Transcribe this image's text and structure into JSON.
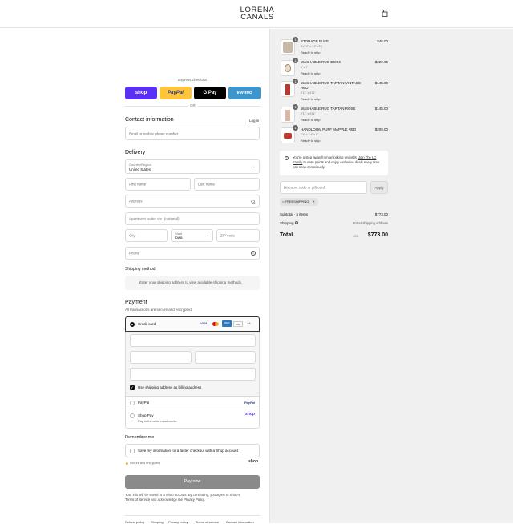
{
  "header": {
    "logo_line1": "LORENA",
    "logo_line2": "CANALS"
  },
  "express": {
    "label": "Express checkout",
    "or": "OR",
    "buttons": [
      {
        "label": "shop"
      },
      {
        "label": "PayPal"
      },
      {
        "label": "G Pay"
      },
      {
        "label": "venmo"
      }
    ],
    "colors": {
      "shop": "#5a31f4",
      "paypal": "#ffc439",
      "gpay": "#000000",
      "venmo": "#3d95ce"
    }
  },
  "contact": {
    "title": "Contact information",
    "login": "Log in",
    "email_placeholder": "Email or mobile phone number"
  },
  "delivery": {
    "title": "Delivery",
    "country_label": "Country/Region",
    "country_value": "United States",
    "first_name": "First name",
    "last_name": "Last name",
    "address": "Address",
    "apartment": "Apartment, suite, etc. (optional)",
    "city": "City",
    "state_label": "State",
    "state_value": "Iowa",
    "zip": "ZIP code",
    "phone": "Phone"
  },
  "shipping_method": {
    "title": "Shipping method",
    "note": "Enter your shipping address to view available shipping methods."
  },
  "payment": {
    "title": "Payment",
    "subtitle": "All transactions are secure and encrypted.",
    "credit_card": "Credit card",
    "cards": [
      "VISA",
      "MC",
      "AMEX",
      "DISC"
    ],
    "more": "+4",
    "billing_same": "Use shipping address as billing address",
    "paypal": "PayPal",
    "paypal_logo": "PayPal",
    "shop_pay": "Shop Pay",
    "shop_pay_sub": "Pay in full or in installments",
    "shop_logo": "shop"
  },
  "remember": {
    "title": "Remember me",
    "save_label": "Save my information for a faster checkout with a Shop account",
    "secure": "Secure and encrypted",
    "shop_logo": "shop"
  },
  "pay_now": "Pay now",
  "legal": {
    "line1": "Your info will be saved to a Shop account. By continuing, you agree to Shop's",
    "terms": "Terms of Service",
    "and": "and acknowledge the",
    "privacy": "Privacy Policy."
  },
  "footer": [
    "Refund policy",
    "Shipping",
    "Privacy policy",
    "Terms of service",
    "Contact information"
  ],
  "cart": {
    "items": [
      {
        "qty": "1",
        "name": "STORAGE PUFF",
        "variant": "S (1'2\" x 1'2\"x 8\")",
        "ship": "Ready to ship",
        "price": "$45.00",
        "thumb_color": "#c9b9a8"
      },
      {
        "qty": "1",
        "name": "WASHABLE RUG DOGS",
        "variant": "6' x 7'",
        "ship": "Ready to ship",
        "price": "$229.00",
        "thumb_color": "#e8ddc8"
      },
      {
        "qty": "1",
        "name": "WASHABLE RUG TARTAN VINTAGE RED",
        "variant": "2'11\" x 4'11\"",
        "ship": "Ready to ship",
        "price": "$145.00",
        "thumb_color": "#b53a33"
      },
      {
        "qty": "1",
        "name": "WASHABLE RUG TARTAN ROSE",
        "variant": "2'11\" x 4'11\"",
        "ship": "Ready to ship",
        "price": "$145.00",
        "thumb_color": "#d9b6a3"
      },
      {
        "qty": "1",
        "name": "HANDLOOM PUFF MAPPLE RED",
        "variant": "1'4\" x 1'4\" x 8\"",
        "ship": "Ready to ship",
        "price": "$209.00",
        "thumb_color": "#c0392b"
      }
    ],
    "rewards_text": "You're a step away from unlocking rewards!",
    "rewards_link": "Join The LC Family",
    "rewards_rest": "to earn points and enjoy exclusive deals every time you shop consciously.",
    "discount_placeholder": "Discount code or gift card",
    "apply": "Apply",
    "tag": "FREESHIPPING",
    "subtotal_label": "Subtotal · 5 items",
    "subtotal": "$773.00",
    "shipping_label": "Shipping",
    "shipping_value": "Enter shipping address",
    "total_label": "Total",
    "currency": "USD",
    "total": "$773.00"
  }
}
